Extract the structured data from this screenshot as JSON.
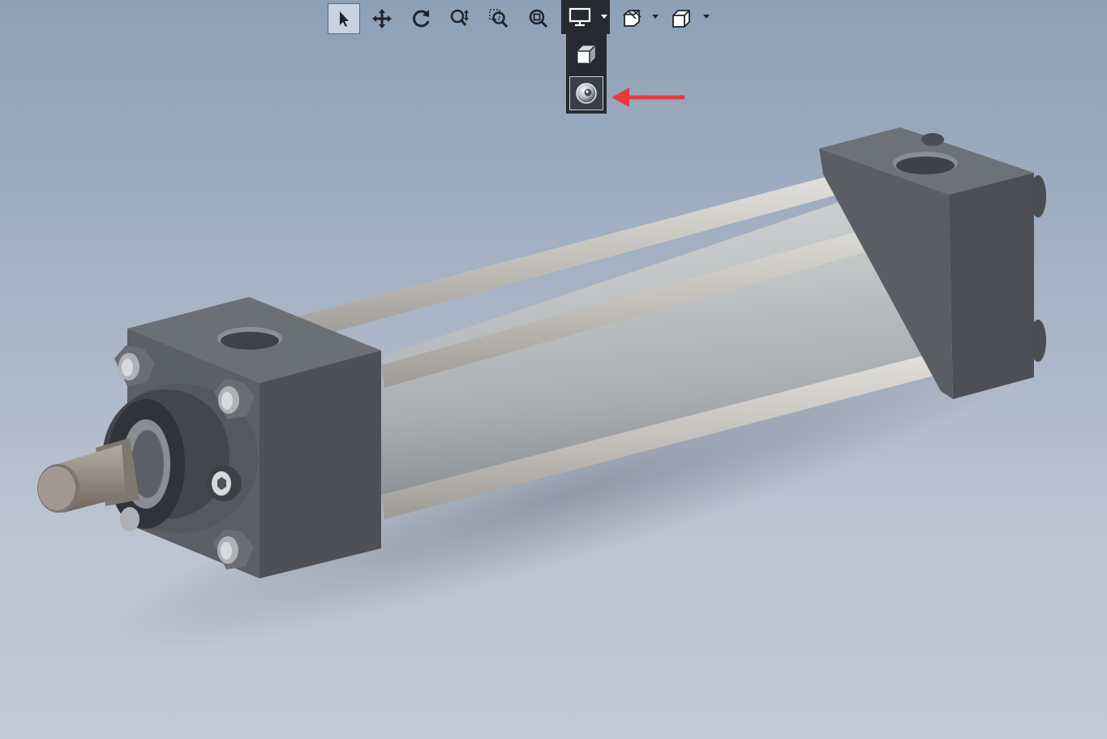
{
  "toolbar": {
    "buttons": [
      {
        "name": "select-icon",
        "selected": true
      },
      {
        "name": "pan-icon"
      },
      {
        "name": "rotate-icon"
      },
      {
        "name": "zoom-in-out-icon"
      },
      {
        "name": "zoom-to-area-icon"
      },
      {
        "name": "zoom-to-fit-icon"
      },
      {
        "name": "display-style-icon",
        "active": true,
        "has_dropdown": true
      },
      {
        "name": "section-view-icon",
        "has_dropdown": true
      },
      {
        "name": "view-orientation-icon",
        "has_dropdown": true
      }
    ],
    "flyout_items": [
      {
        "name": "shaded-cube-icon"
      },
      {
        "name": "realview-sphere-icon",
        "highlighted": true
      }
    ]
  },
  "annotation": {
    "type": "arrow",
    "color": "#e63b3b",
    "points_to": "realview-sphere-icon"
  },
  "colors": {
    "background_top": "#8ea0b6",
    "background_bottom": "#c3cad6",
    "block_dark": "#55595f",
    "tube_light": "#b9bcbe",
    "rod": "#8f877d",
    "toolbar_active": "#262a30"
  }
}
